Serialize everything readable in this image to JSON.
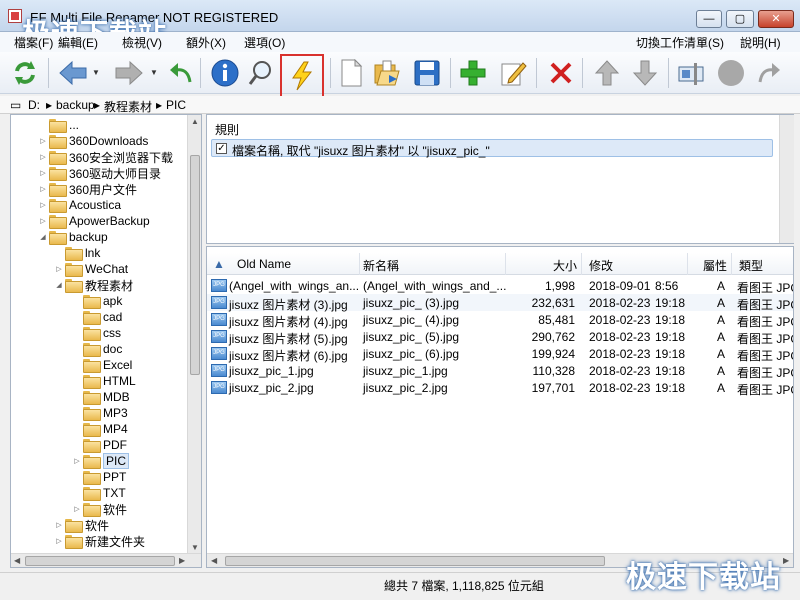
{
  "window": {
    "title": "EF Multi File Renamer NOT REGISTERED",
    "watermark": "极速下载站"
  },
  "menu": {
    "left": [
      "檔案(F)",
      "編輯(E)",
      "檢視(V)",
      "額外(X)",
      "選項(O)"
    ],
    "switch_worklist": "切換工作清單(S)",
    "help": "說明(H)"
  },
  "toolbar": {
    "icons": [
      "refresh-icon",
      "back-icon",
      "forward-icon",
      "undo-icon",
      "info-icon",
      "search-icon",
      "lightning-icon",
      "new-file-icon",
      "open-folder-icon",
      "save-icon",
      "add-icon",
      "edit-icon",
      "delete-icon",
      "move-up-icon",
      "move-down-icon",
      "settings-icon",
      "record-icon",
      "redo-icon"
    ],
    "highlight_color": "#d9322e"
  },
  "path": {
    "segments": [
      "D:",
      "backup",
      "教程素材",
      "PIC"
    ],
    "separator": "▸"
  },
  "tree": {
    "items": [
      {
        "label": "...",
        "level": 1,
        "expander": "none"
      },
      {
        "label": "360Downloads",
        "level": 1,
        "expander": "closed"
      },
      {
        "label": "360安全浏览器下载",
        "level": 1,
        "expander": "closed"
      },
      {
        "label": "360驱动大师目录",
        "level": 1,
        "expander": "closed"
      },
      {
        "label": "360用户文件",
        "level": 1,
        "expander": "closed"
      },
      {
        "label": "Acoustica",
        "level": 1,
        "expander": "closed"
      },
      {
        "label": "ApowerBackup",
        "level": 1,
        "expander": "closed"
      },
      {
        "label": "backup",
        "level": 1,
        "expander": "open"
      },
      {
        "label": "lnk",
        "level": 2,
        "expander": "none"
      },
      {
        "label": "WeChat",
        "level": 2,
        "expander": "closed"
      },
      {
        "label": "教程素材",
        "level": 2,
        "expander": "open"
      },
      {
        "label": "apk",
        "level": 3,
        "expander": "none"
      },
      {
        "label": "cad",
        "level": 3,
        "expander": "none"
      },
      {
        "label": "css",
        "level": 3,
        "expander": "none"
      },
      {
        "label": "doc",
        "level": 3,
        "expander": "none"
      },
      {
        "label": "Excel",
        "level": 3,
        "expander": "none"
      },
      {
        "label": "HTML",
        "level": 3,
        "expander": "none"
      },
      {
        "label": "MDB",
        "level": 3,
        "expander": "none"
      },
      {
        "label": "MP3",
        "level": 3,
        "expander": "none"
      },
      {
        "label": "MP4",
        "level": 3,
        "expander": "none"
      },
      {
        "label": "PDF",
        "level": 3,
        "expander": "none"
      },
      {
        "label": "PIC",
        "level": 3,
        "expander": "closed",
        "selected": true
      },
      {
        "label": "PPT",
        "level": 3,
        "expander": "none"
      },
      {
        "label": "TXT",
        "level": 3,
        "expander": "none"
      },
      {
        "label": "软件",
        "level": 3,
        "expander": "closed"
      },
      {
        "label": "软件",
        "level": 2,
        "expander": "closed"
      },
      {
        "label": "新建文件夹",
        "level": 2,
        "expander": "closed"
      }
    ]
  },
  "rules": {
    "header": "規則",
    "items": [
      {
        "checked": true,
        "check_mark": "✓",
        "text": "檔案名稱, 取代 \"jisuxz 图片素材\" 以 \"jisuxz_pic_\""
      }
    ]
  },
  "files": {
    "columns": {
      "old_name": "Old Name",
      "new_name": "新名稱",
      "size": "大小",
      "modified": "修改",
      "attr": "屬性",
      "type": "類型"
    },
    "rows": [
      {
        "old": "(Angel_with_wings_an...",
        "new": "(Angel_with_wings_and_...",
        "size": "1,998",
        "date": "2018-09-01",
        "time": "8:56",
        "attr": "A",
        "type": "看图王 JPG"
      },
      {
        "old": "jisuxz 图片素材 (3).jpg",
        "new": "jisuxz_pic_ (3).jpg",
        "size": "232,631",
        "date": "2018-02-23",
        "time": "19:18",
        "attr": "A",
        "type": "看图王 JPG"
      },
      {
        "old": "jisuxz 图片素材 (4).jpg",
        "new": "jisuxz_pic_ (4).jpg",
        "size": "85,481",
        "date": "2018-02-23",
        "time": "19:18",
        "attr": "A",
        "type": "看图王 JPG"
      },
      {
        "old": "jisuxz 图片素材 (5).jpg",
        "new": "jisuxz_pic_ (5).jpg",
        "size": "290,762",
        "date": "2018-02-23",
        "time": "19:18",
        "attr": "A",
        "type": "看图王 JPG"
      },
      {
        "old": "jisuxz 图片素材 (6).jpg",
        "new": "jisuxz_pic_ (6).jpg",
        "size": "199,924",
        "date": "2018-02-23",
        "time": "19:18",
        "attr": "A",
        "type": "看图王 JPG"
      },
      {
        "old": "jisuxz_pic_1.jpg",
        "new": "jisuxz_pic_1.jpg",
        "size": "110,328",
        "date": "2018-02-23",
        "time": "19:18",
        "attr": "A",
        "type": "看图王 JPG"
      },
      {
        "old": "jisuxz_pic_2.jpg",
        "new": "jisuxz_pic_2.jpg",
        "size": "197,701",
        "date": "2018-02-23",
        "time": "19:18",
        "attr": "A",
        "type": "看图王 JPG"
      }
    ]
  },
  "status": {
    "text": "總共 7 檔案, 1,118,825 位元組"
  }
}
